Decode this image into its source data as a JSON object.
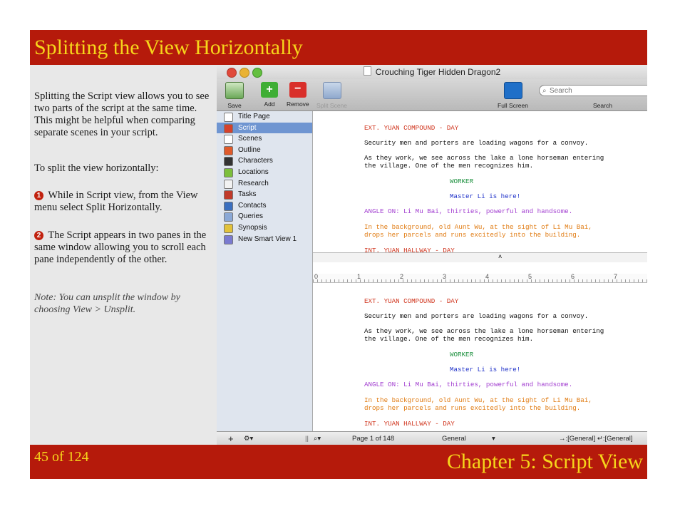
{
  "slide": {
    "title": "Splitting the View Horizontally",
    "page_counter": "45 of 124",
    "chapter": "Chapter 5: Script View",
    "colors": {
      "banner": "#b51a0b",
      "banner_text": "#f6d51b",
      "panel": "#e8e8e8"
    },
    "para1": "Splitting the Script view allows you to see two parts of the script at the same time. This might be helpful when comparing separate scenes in your script.",
    "para2": "To split the view horizontally:",
    "step1_num": "1",
    "step1": "While in Script view, from the View menu select Split Horizontally.",
    "step2_num": "2",
    "step2": "The Script appears in two panes in the same window allowing you to scroll each pane independently of the other.",
    "note": "Note: You can unsplit the window by choosing View > Unsplit."
  },
  "window": {
    "title": "Crouching Tiger Hidden Dragon2",
    "toolbar": {
      "save": "Save",
      "add": "Add",
      "remove": "Remove",
      "split_scene": "Split Scene",
      "full_screen": "Full Screen",
      "search_label": "Search",
      "search_placeholder": "Search"
    },
    "sidebar": [
      {
        "label": "Title Page",
        "icon": "title-page-icon",
        "color": "#ffffff"
      },
      {
        "label": "Script",
        "icon": "script-icon",
        "color": "#d6412b"
      },
      {
        "label": "Scenes",
        "icon": "scenes-icon",
        "color": "#ffffff"
      },
      {
        "label": "Outline",
        "icon": "outline-icon",
        "color": "#e05a2b"
      },
      {
        "label": "Characters",
        "icon": "characters-icon",
        "color": "#333333"
      },
      {
        "label": "Locations",
        "icon": "locations-icon",
        "color": "#7cbf3c"
      },
      {
        "label": "Research",
        "icon": "research-icon",
        "color": "#f2f2f2"
      },
      {
        "label": "Tasks",
        "icon": "tasks-icon",
        "color": "#c03a2b"
      },
      {
        "label": "Contacts",
        "icon": "contacts-icon",
        "color": "#3a6fc0"
      },
      {
        "label": "Queries",
        "icon": "queries-icon",
        "color": "#8aa8d6"
      },
      {
        "label": "Synopsis",
        "icon": "synopsis-icon",
        "color": "#e2c23a"
      },
      {
        "label": "New Smart View 1",
        "icon": "smart-view-icon",
        "color": "#7a7ad0"
      }
    ],
    "script_lines": [
      {
        "text": "EXT. YUAN COMPOUND - DAY",
        "color": "#d0361f"
      },
      {
        "text": "Security men and porters are loading wagons for a convoy.",
        "color": "#111111"
      },
      {
        "text": "As they work, we see across the lake a lone horseman entering",
        "color": "#111111"
      },
      {
        "text": "the village.  One of the men recognizes him.",
        "color": "#111111"
      },
      {
        "text": "WORKER",
        "color": "#1a8f3c"
      },
      {
        "text": "Master Li is here!",
        "color": "#2133c9"
      },
      {
        "text": "ANGLE ON: Li Mu Bai, thirties, powerful and handsome.",
        "color": "#a23fd0"
      },
      {
        "text": "In the background, old Aunt Wu, at the sight of Li Mu Bai,",
        "color": "#e07a10"
      },
      {
        "text": "drops her parcels and runs excitedly into the building.",
        "color": "#e07a10"
      },
      {
        "text": "INT. YUAN HALLWAY - DAY",
        "color": "#d0361f"
      }
    ],
    "ruler": [
      "0",
      "1",
      "2",
      "3",
      "4",
      "5",
      "6",
      "7"
    ],
    "status": {
      "plus": "+",
      "gear": "⚙▾",
      "page": "Page 1 of 148",
      "style": "General",
      "tab_enter": "→:[General] ↵:[General]"
    }
  }
}
